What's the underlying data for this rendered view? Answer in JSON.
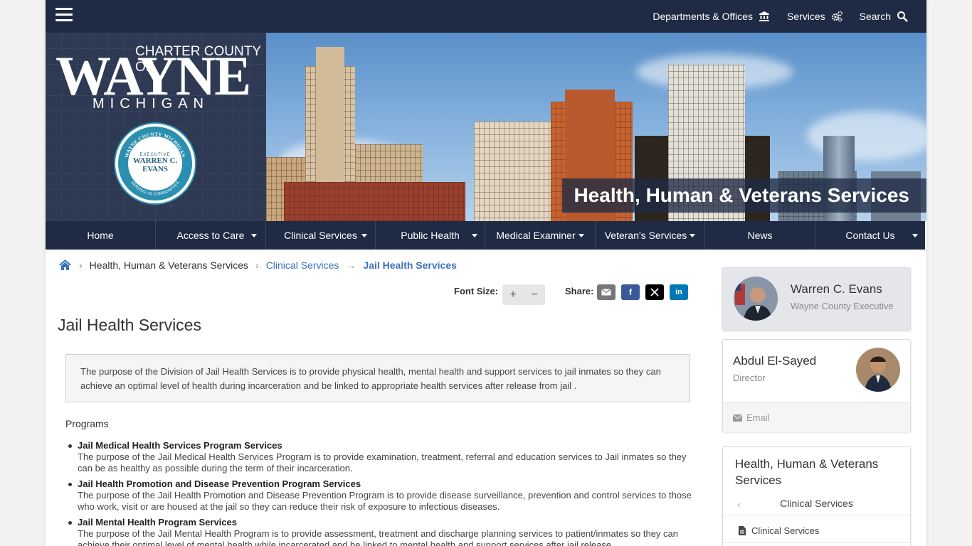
{
  "topbar": {
    "links": [
      {
        "label": "Departments & Offices",
        "icon": "institution-icon"
      },
      {
        "label": "Services",
        "icon": "gears-icon"
      },
      {
        "label": "Search",
        "icon": "search-icon"
      }
    ]
  },
  "banner": {
    "logo": {
      "charter": "CHARTER COUNTY OF",
      "wayne": "WAYNE",
      "michigan": "MICHIGAN"
    },
    "seal": {
      "executive": "EXECUTIVE",
      "name_line1": "WARREN C.",
      "name_line2": "EVANS",
      "ring_top": "WAYNE COUNTY MICHIGAN",
      "ring_bottom": "SERVING 43 COMMUNITIES"
    },
    "section_title": "Health, Human & Veterans Services"
  },
  "mainnav": {
    "items": [
      {
        "label": "Home",
        "dropdown": false
      },
      {
        "label": "Access to Care",
        "dropdown": true
      },
      {
        "label": "Clinical Services",
        "dropdown": true
      },
      {
        "label": "Public Health",
        "dropdown": true
      },
      {
        "label": "Medical Examiner",
        "dropdown": true
      },
      {
        "label": "Veteran's Services",
        "dropdown": true
      },
      {
        "label": "News",
        "dropdown": false
      },
      {
        "label": "Contact Us",
        "dropdown": true
      }
    ]
  },
  "breadcrumb": {
    "items": [
      "Health, Human & Veterans Services",
      "Clinical Services",
      "Jail Health Services"
    ]
  },
  "tools": {
    "font_size_label": "Font Size:",
    "increase": "+",
    "decrease": "−",
    "share_label": "Share:",
    "share": [
      "email",
      "facebook",
      "x",
      "linkedin"
    ]
  },
  "content": {
    "title": "Jail Health Services",
    "intro": "The purpose of the Division of Jail Health Services is to provide physical health, mental health and support services to jail inmates so they can achieve an optimal level of health during incarceration and be linked to appropriate health services after release from jail .",
    "programs_heading": "Programs",
    "programs": [
      {
        "title": "Jail Medical Health Services Program Services",
        "desc": "The purpose of the Jail Medical Health Services Program is to provide examination, treatment, referral and education services to Jail inmates so they can be as healthy as possible during the term of their incarceration."
      },
      {
        "title": "Jail Health Promotion and Disease Prevention Program Services",
        "desc": "The purpose of the Jail Health Promotion and Disease Prevention Program is to provide disease surveillance, prevention and control services to those who work, visit or are housed at the jail so they can reduce their risk of exposure to infectious diseases."
      },
      {
        "title": "Jail Mental Health Program Services",
        "desc": "The purpose of the Jail Mental Health Program is to provide assessment, treatment and discharge planning services to patient/inmates so they can achieve their optimal level of mental health while incarcerated and be linked to mental health and support services after jail release."
      }
    ]
  },
  "sidebar": {
    "executive": {
      "name": "Warren C. Evans",
      "role": "Wayne County Executive"
    },
    "director": {
      "name": "Abdul El-Sayed",
      "role": "Director",
      "email_label": "Email"
    },
    "nav": {
      "title": "Health, Human & Veterans Services",
      "back_label": "Clinical Services",
      "item": "Clinical Services"
    }
  },
  "colors": {
    "navy": "#1f2a44",
    "link": "#3b73b9",
    "seal": "#2b8fb0"
  }
}
